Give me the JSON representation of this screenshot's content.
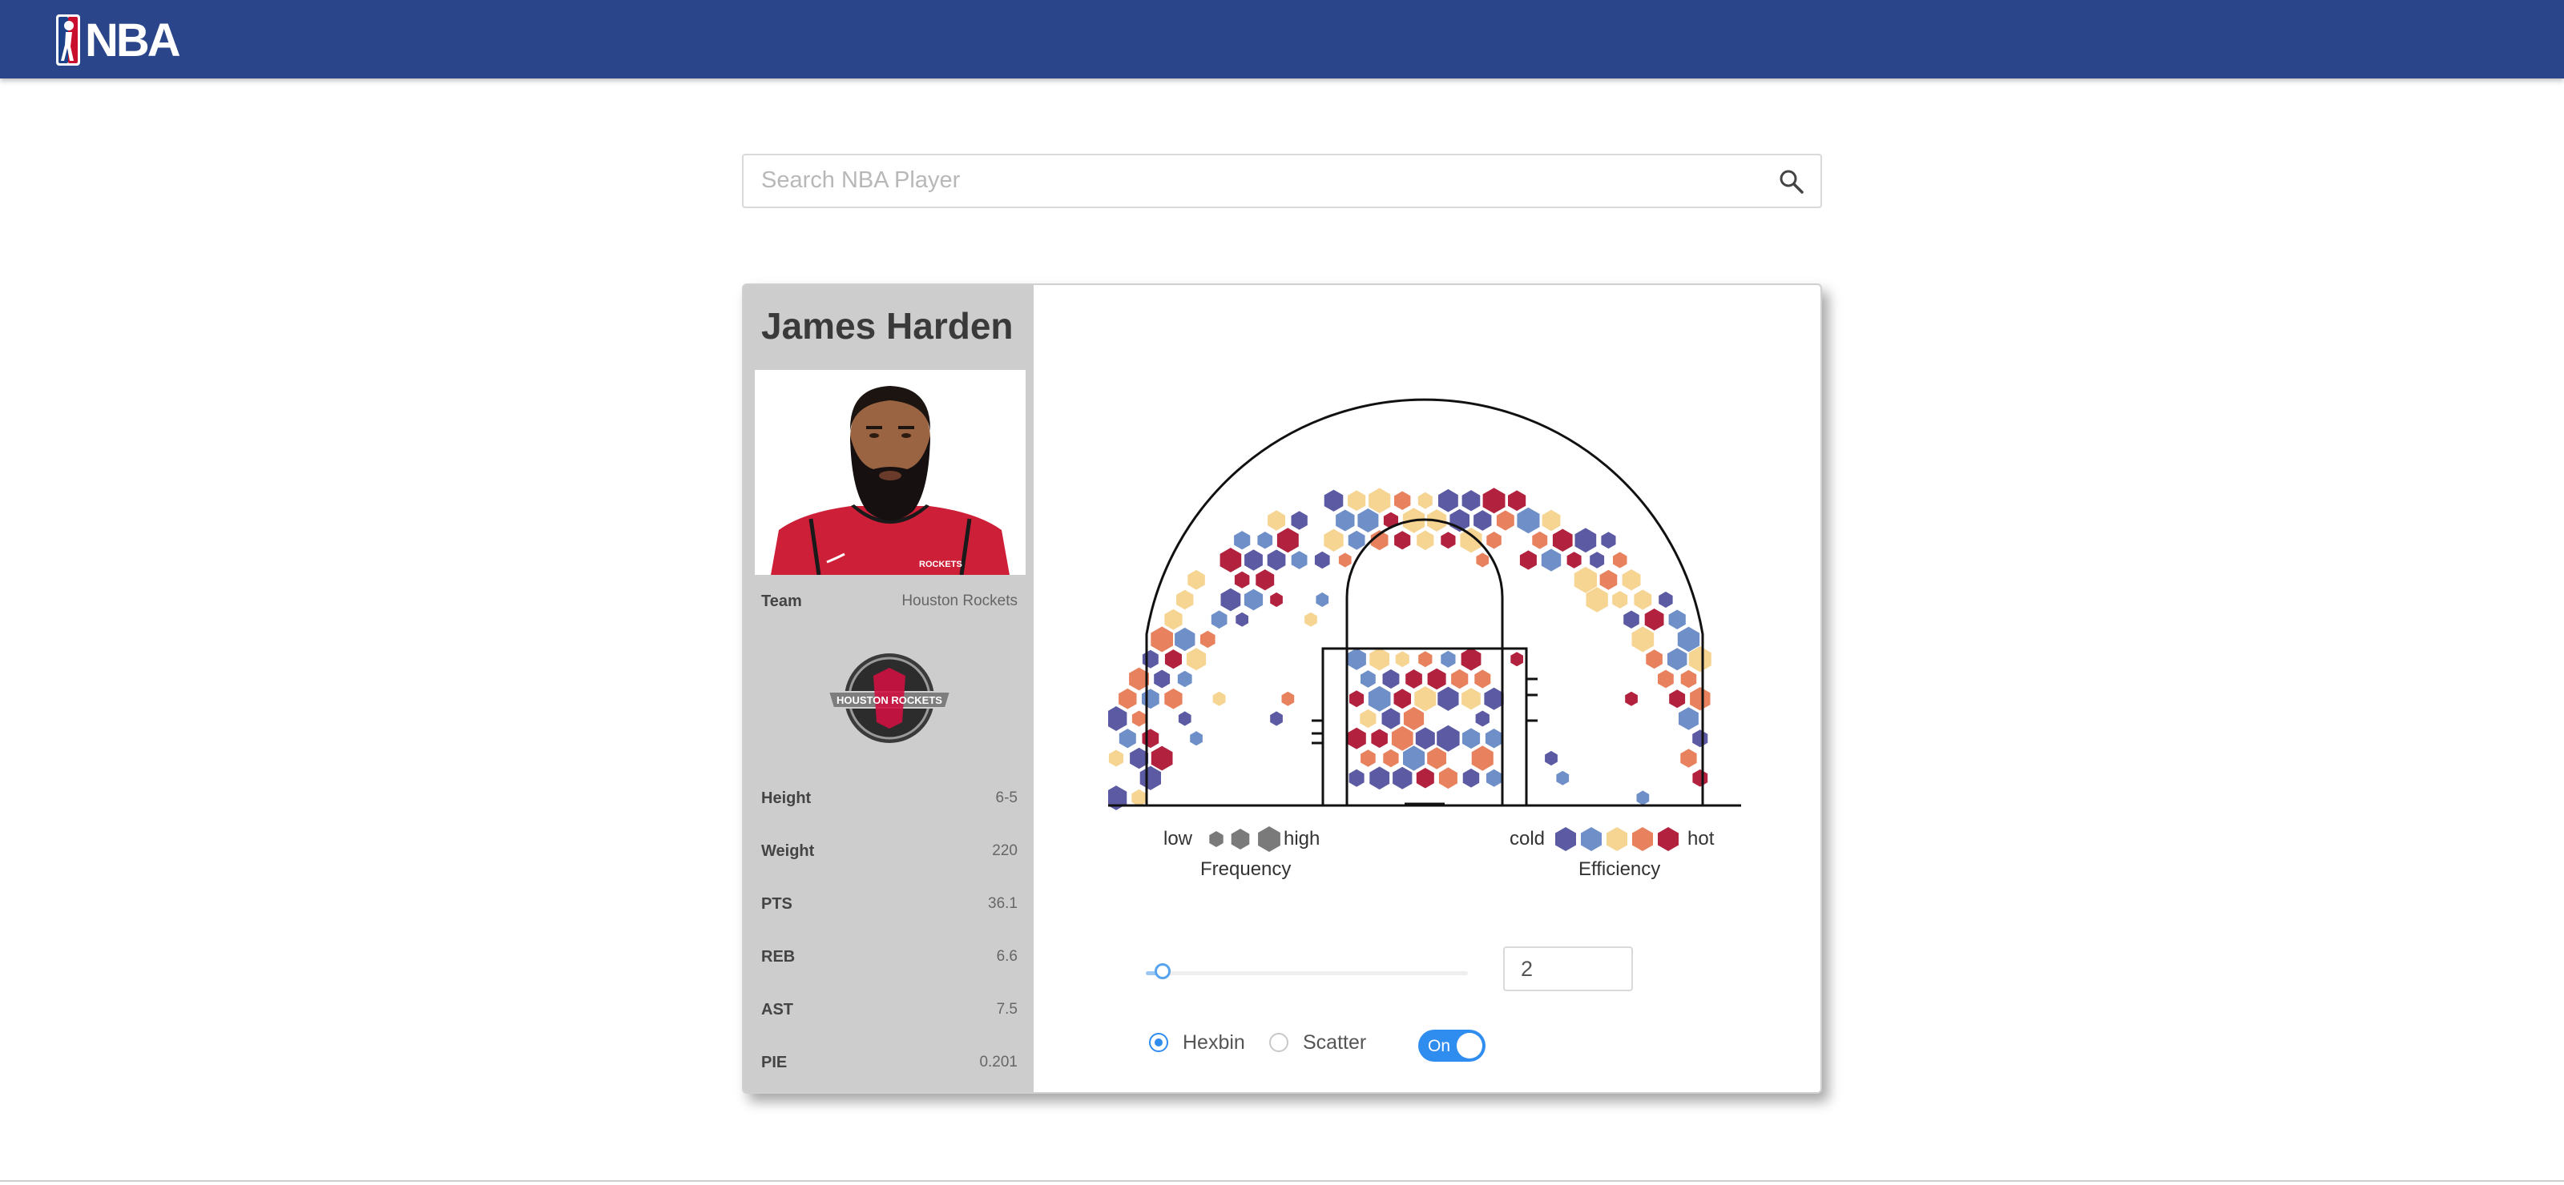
{
  "header": {
    "logo_text": "NBA",
    "logo_icon": "nba-logo-icon"
  },
  "search": {
    "placeholder": "Search NBA Player",
    "icon": "search-icon"
  },
  "player": {
    "name": "James Harden",
    "team_label": "Team",
    "team_value": "Houston Rockets",
    "jersey_text": "ROCKETS",
    "team_logo_text": "HOUSTON ROCKETS",
    "stats": [
      {
        "label": "Height",
        "value": "6-5"
      },
      {
        "label": "Weight",
        "value": "220"
      },
      {
        "label": "PTS",
        "value": "36.1"
      },
      {
        "label": "REB",
        "value": "6.6"
      },
      {
        "label": "AST",
        "value": "7.5"
      },
      {
        "label": "PIE",
        "value": "0.201"
      }
    ]
  },
  "legend": {
    "frequency_low": "low",
    "frequency_high": "high",
    "frequency_title": "Frequency",
    "efficiency_cold": "cold",
    "efficiency_hot": "hot",
    "efficiency_title": "Efficiency",
    "efficiency_colors": [
      "#5b5aa3",
      "#6f8fc8",
      "#f6d491",
      "#e8815d",
      "#b2223f"
    ],
    "frequency_color": "#7a7a7a"
  },
  "controls": {
    "slider_value": 2,
    "slider_fraction": 0.02,
    "number_value": "2",
    "mode_options": [
      "Hexbin",
      "Scatter"
    ],
    "selected_mode": "Hexbin",
    "toggle_label": "On",
    "toggle_state": true
  }
}
